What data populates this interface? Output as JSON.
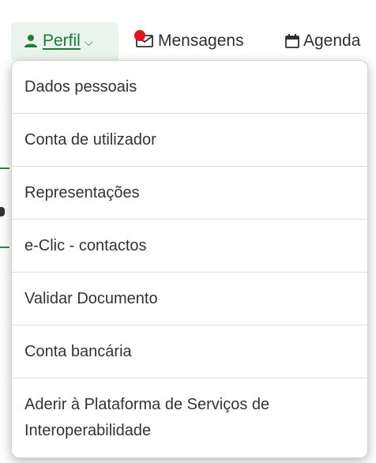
{
  "nav": {
    "perfil_label": "Perfil",
    "mensagens_label": "Mensagens",
    "agenda_label": "Agenda",
    "colors": {
      "perfil_accent": "#1c7c3a",
      "perfil_bg": "#eaf3ec",
      "notification": "#e0141e"
    },
    "icons": {
      "perfil": "user-icon",
      "perfil_caret": "chevron-down-icon",
      "mensagens": "envelope-icon",
      "agenda": "calendar-icon"
    }
  },
  "dropdown": {
    "items": [
      {
        "label": "Dados pessoais"
      },
      {
        "label": "Conta de utilizador"
      },
      {
        "label": "Representações"
      },
      {
        "label": "e-Clic - contactos"
      },
      {
        "label": "Validar Documento"
      },
      {
        "label": "Conta bancária"
      },
      {
        "label": "Aderir à Plataforma de Serviços de Interoperabilidade"
      }
    ]
  }
}
